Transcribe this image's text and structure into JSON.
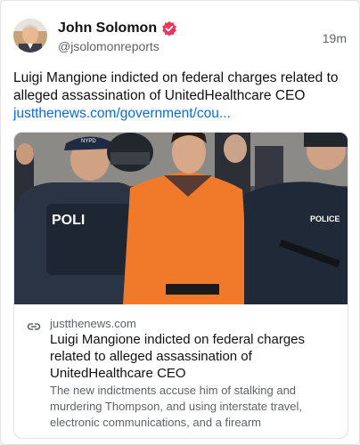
{
  "post": {
    "author_name": "John Solomon",
    "author_handle": "@jsolomonreports",
    "timestamp": "19m",
    "verified_color": "#e8375d",
    "text": "Luigi Mangione indicted on federal charges related to alleged assassination of UnitedHealthcare CEO",
    "link_text": "justthenews.com/government/cou..."
  },
  "embed": {
    "domain": "justthenews.com",
    "title": "Luigi Mangione indicted on federal charges related to alleged assassination of UnitedHealthcare CEO",
    "description": "The new indictments accuse him of stalking and murdering Thompson, and using interstate travel, electronic communications, and a firearm",
    "photo_labels": {
      "vest": "POLI",
      "cap": "NYPD",
      "vest_right": "POLICE"
    }
  },
  "colors": {
    "link": "#0b6bd6",
    "jumpsuit": "#f07a2a",
    "police_navy": "#1f2a3a"
  }
}
